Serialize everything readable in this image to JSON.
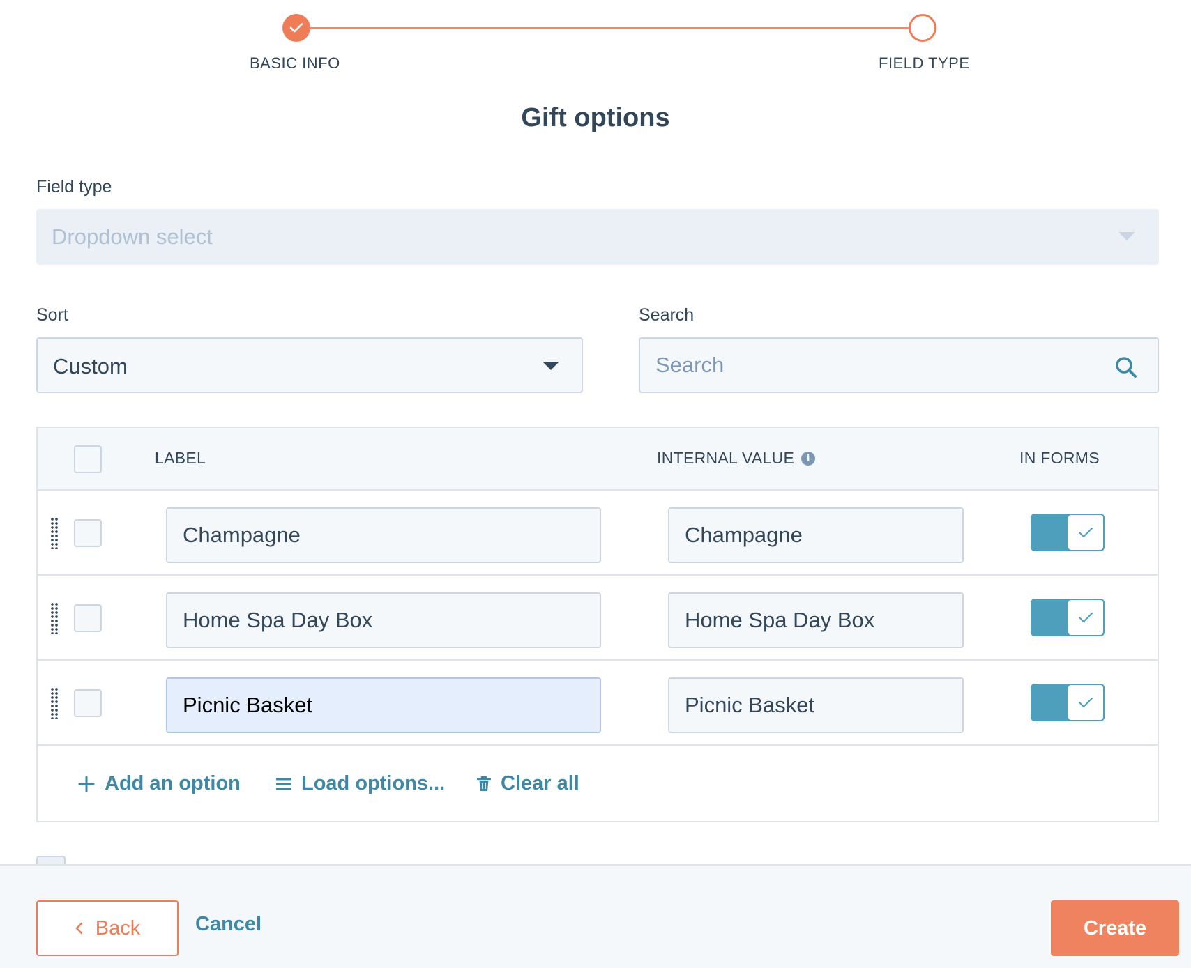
{
  "stepper": {
    "steps": [
      {
        "label": "BASIC INFO",
        "state": "complete"
      },
      {
        "label": "FIELD TYPE",
        "state": "current"
      }
    ],
    "accent_color": "#ee7d57"
  },
  "title": "Gift options",
  "field_type": {
    "label": "Field type",
    "value": "Dropdown select",
    "disabled": true
  },
  "sort": {
    "label": "Sort",
    "value": "Custom"
  },
  "search": {
    "label": "Search",
    "placeholder": "Search",
    "value": ""
  },
  "table": {
    "headers": {
      "label": "LABEL",
      "internal_value": "INTERNAL VALUE",
      "in_forms": "IN FORMS"
    },
    "rows": [
      {
        "label": "Champagne",
        "internal_value": "Champagne",
        "in_forms": true
      },
      {
        "label": "Home Spa Day Box",
        "internal_value": "Home Spa Day Box",
        "in_forms": true
      },
      {
        "label": "Picnic Basket",
        "internal_value": "Picnic Basket",
        "in_forms": true
      }
    ],
    "actions": {
      "add": "Add an option",
      "load": "Load options...",
      "clear": "Clear all"
    }
  },
  "footer": {
    "back": "Back",
    "cancel": "Cancel",
    "create": "Create"
  },
  "colors": {
    "primary_orange": "#ee7d57",
    "link_teal": "#3e88a6",
    "toggle_on": "#4d9fbb",
    "text": "#33475b"
  }
}
